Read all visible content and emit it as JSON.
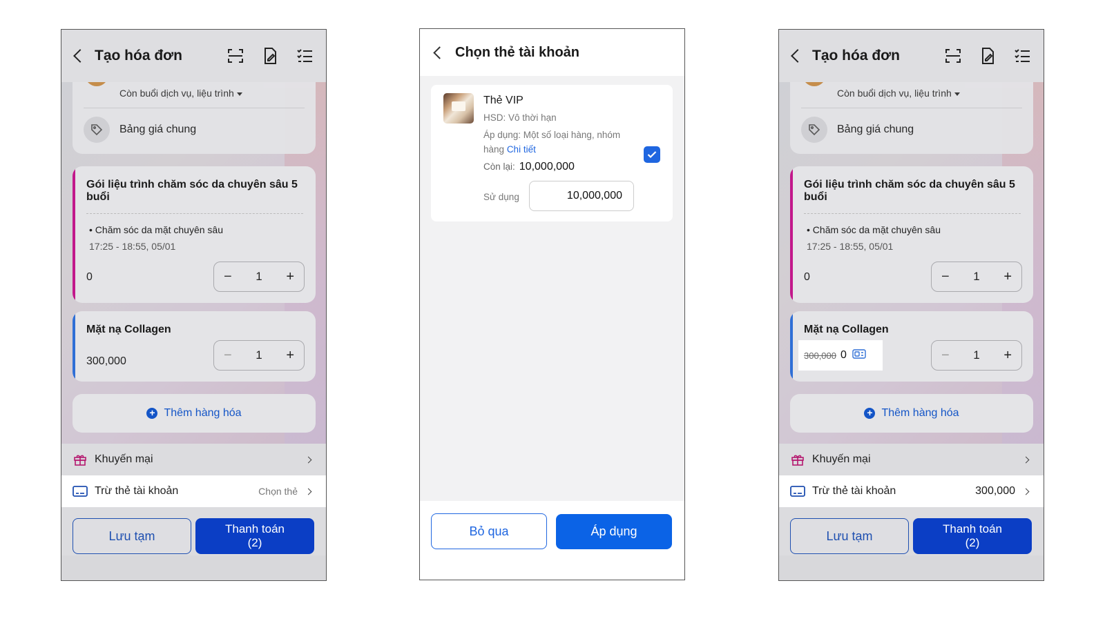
{
  "colors": {
    "primary": "#0b3ec5",
    "link": "#1f66e0",
    "package_accent": "#c2188b",
    "product_accent": "#2f6fd6"
  },
  "screen1": {
    "header": {
      "title": "Tạo hóa đơn",
      "icons": [
        "scan-icon",
        "edit-document-icon",
        "checklist-icon"
      ]
    },
    "customer": {
      "sub": "Còn buổi dịch vụ, liệu trình"
    },
    "price_list": "Bảng giá chung",
    "package": {
      "title": "Gói liệu trình chăm sóc da chuyên sâu 5 buổi",
      "service": "• Chăm sóc da mặt chuyên sâu",
      "time": "17:25 - 18:55, 05/01",
      "price": "0",
      "qty": "1"
    },
    "product": {
      "title": "Mặt nạ Collagen",
      "price": "300,000",
      "qty": "1"
    },
    "add_item": "Thêm hàng hóa",
    "promotion": "Khuyến mại",
    "account_card": {
      "label": "Trừ thẻ tài khoản",
      "value": "Chọn thẻ"
    },
    "save_label": "Lưu tạm",
    "pay_label": "Thanh toán",
    "pay_count": "(2)"
  },
  "screen2": {
    "header": {
      "title": "Chọn thẻ tài khoản"
    },
    "card": {
      "name": "Thẻ VIP",
      "hsd": "HSD: Vô thời hạn",
      "apply": "Áp dụng: Một số loại hàng, nhóm hàng",
      "detail_link": "Chi tiết",
      "remain_label": "Còn lại:",
      "remain_value": "10,000,000",
      "use_label": "Sử dụng",
      "use_value": "10,000,000",
      "checked": true
    },
    "skip_label": "Bỏ qua",
    "apply_label": "Áp dụng"
  },
  "screen3": {
    "header": {
      "title": "Tạo hóa đơn"
    },
    "customer": {
      "sub": "Còn buổi dịch vụ, liệu trình"
    },
    "price_list": "Bảng giá chung",
    "package": {
      "title": "Gói liệu trình chăm sóc da chuyên sâu 5 buổi",
      "service": "• Chăm sóc da mặt chuyên sâu",
      "time": "17:25 - 18:55, 05/01",
      "price": "0",
      "qty": "1"
    },
    "product": {
      "title": "Mặt nạ Collagen",
      "old_price": "300,000",
      "new_price": "0",
      "qty": "1"
    },
    "add_item": "Thêm hàng hóa",
    "promotion": "Khuyến mại",
    "account_card": {
      "label": "Trừ thẻ tài khoản",
      "value": "300,000"
    },
    "save_label": "Lưu tạm",
    "pay_label": "Thanh toán",
    "pay_count": "(2)"
  }
}
